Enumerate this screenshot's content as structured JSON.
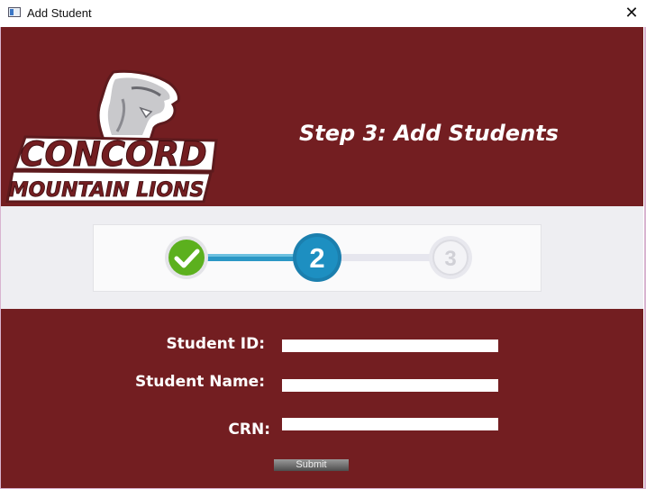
{
  "window": {
    "title": "Add Student"
  },
  "header": {
    "logo_text_line1": "CONCORD",
    "logo_text_line2": "MOUNTAIN LIONS",
    "step_title": "Step 3: Add Students"
  },
  "progress": {
    "steps": [
      {
        "label": "1",
        "state": "complete",
        "icon": "check-icon"
      },
      {
        "label": "2",
        "state": "current"
      },
      {
        "label": "3",
        "state": "pending"
      }
    ]
  },
  "form": {
    "student_id_label": "Student ID:",
    "student_id_value": "",
    "student_name_label": "Student Name:",
    "student_name_value": "",
    "crn_label": "CRN:",
    "crn_value": "",
    "submit_label": "Submit"
  },
  "colors": {
    "maroon": "#731e21",
    "step_band": "#eeeef2",
    "step_blue": "#1d8fc1",
    "check_green": "#5cb01e"
  }
}
